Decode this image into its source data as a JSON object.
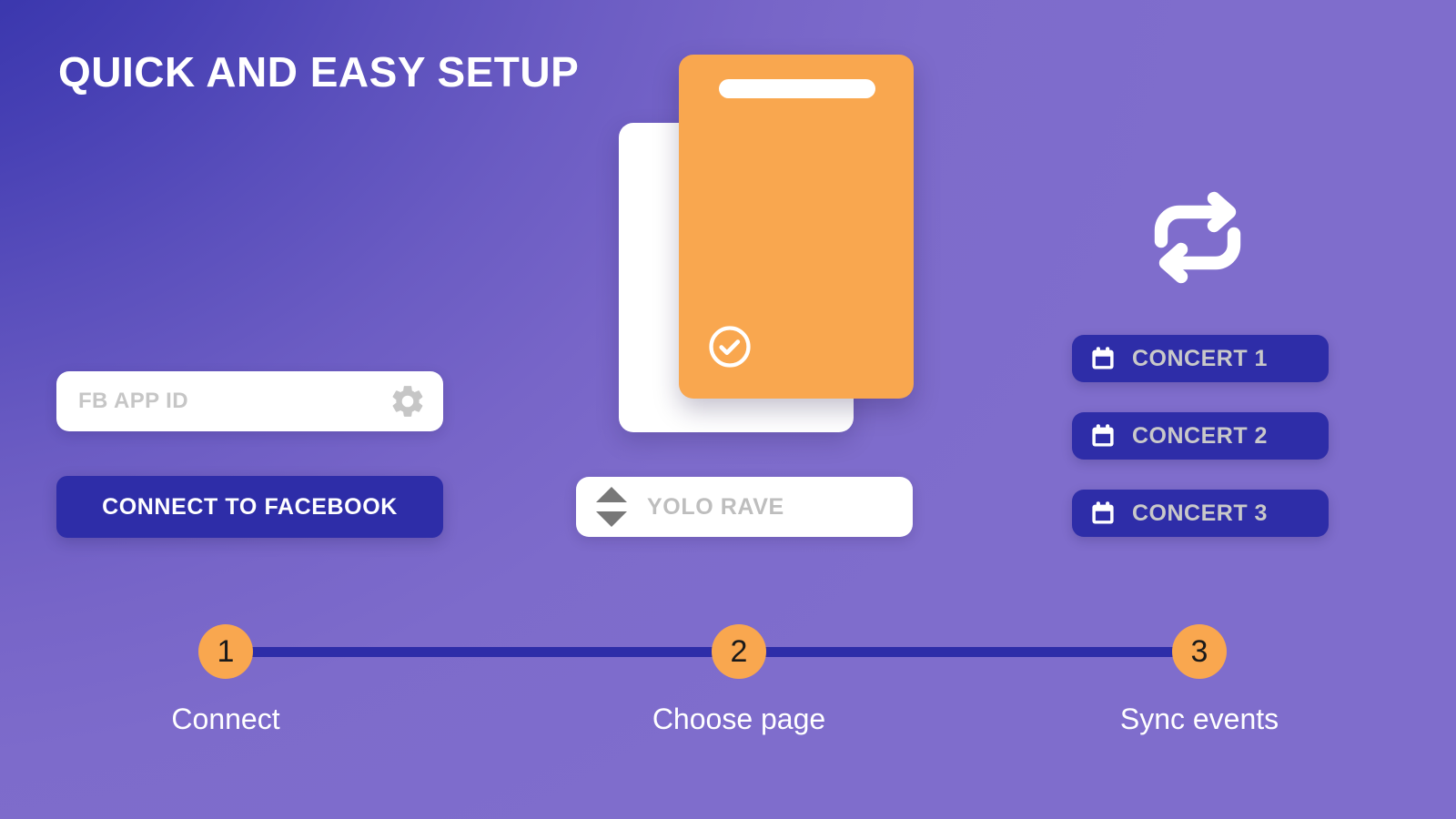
{
  "header": {
    "title": "QUICK AND EASY SETUP"
  },
  "connect_panel": {
    "app_id_input": {
      "value": "",
      "placeholder": "FB APP ID",
      "icon": "gear-icon"
    },
    "connect_button_label": "CONNECT TO FACEBOOK"
  },
  "choose_page_panel": {
    "card_front_icon": "check-circle-icon",
    "page_select": {
      "value": "YOLO RAVE",
      "spinner_up_icon": "triangle-up-icon",
      "spinner_down_icon": "triangle-down-icon"
    }
  },
  "sync_panel": {
    "sync_icon": "repeat-sync-icon",
    "events": [
      {
        "label": "CONCERT 1",
        "icon": "calendar-icon"
      },
      {
        "label": "CONCERT 2",
        "icon": "calendar-icon"
      },
      {
        "label": "CONCERT 3",
        "icon": "calendar-icon"
      }
    ]
  },
  "stepper": {
    "steps": [
      {
        "number": "1",
        "label": "Connect"
      },
      {
        "number": "2",
        "label": "Choose page"
      },
      {
        "number": "3",
        "label": "Sync events"
      }
    ]
  },
  "colors": {
    "gradient_start": "#2E2FA6",
    "gradient_end": "#7F6DCC",
    "accent_orange": "#F9A74F",
    "accent_indigo": "#2E2DA8",
    "text_white": "#FFFFFF",
    "placeholder_gray": "#C6C6C6"
  }
}
